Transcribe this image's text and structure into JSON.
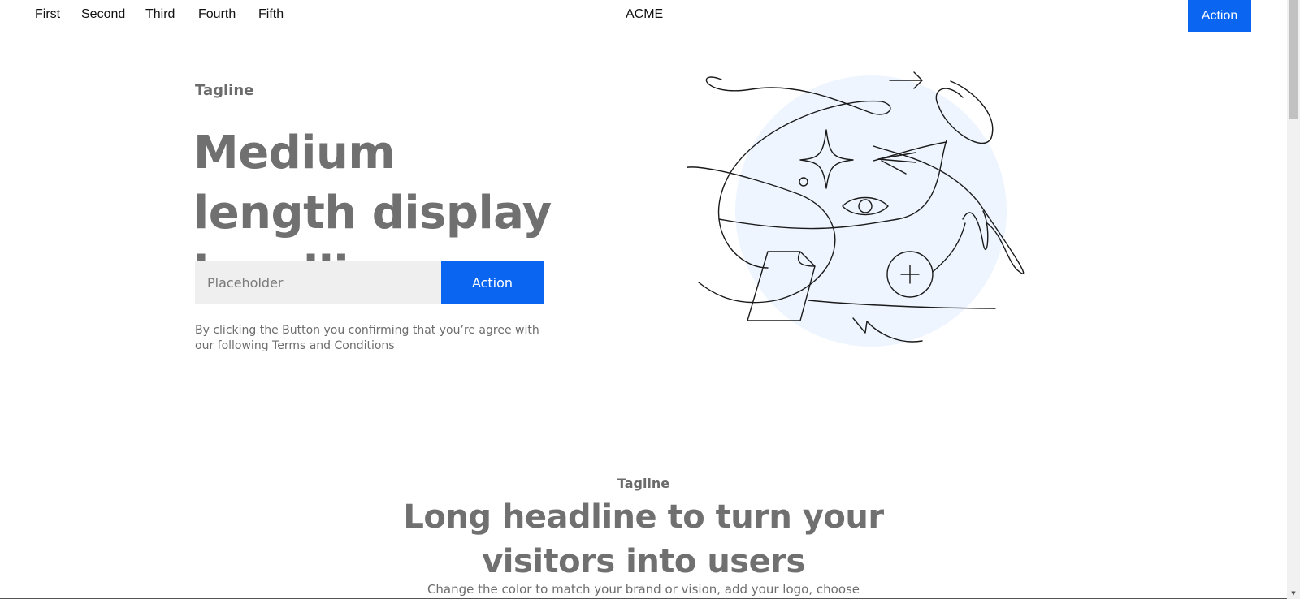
{
  "nav": {
    "links": [
      "First",
      "Second",
      "Third",
      "Fourth",
      "Fifth"
    ],
    "brand": "ACME",
    "action_label": "Action"
  },
  "hero": {
    "tagline": "Tagline",
    "headline": "Medium length display headline",
    "input_placeholder": "Placeholder",
    "action_label": "Action",
    "terms": "By clicking the Button you confirming that you’re agree with our following Terms and Conditions",
    "illustration_fill": "#eef5ff"
  },
  "section2": {
    "tagline": "Tagline",
    "headline": "Long headline to turn your visitors into users",
    "body": "Change the color to match your brand or vision, add your logo, choose"
  },
  "colors": {
    "accent": "#0a66f0",
    "text_muted": "#707070"
  }
}
